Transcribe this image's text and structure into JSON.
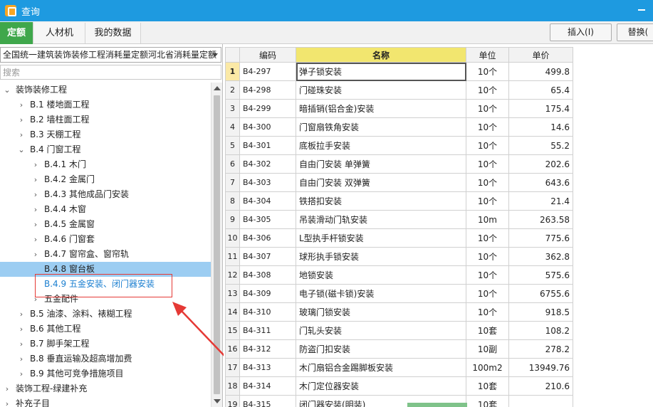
{
  "window": {
    "title": "查询",
    "app_icon": "quota-app-icon",
    "accent": "#1e9ae0"
  },
  "tabs": [
    {
      "label": "定额",
      "active": true
    },
    {
      "label": "人材机",
      "active": false
    },
    {
      "label": "我的数据",
      "active": false
    }
  ],
  "toolbar": {
    "insert_label": "插入(I)",
    "replace_label": "替换("
  },
  "left": {
    "quota_library": "全国统一建筑装饰装修工程消耗量定额河北省消耗量定额",
    "search_placeholder": "搜索",
    "tree": [
      {
        "label": "装饰装修工程",
        "expanded": true
      },
      {
        "label": "B.1 楼地面工程",
        "expanded": false
      },
      {
        "label": "B.2 墙柱面工程",
        "expanded": false
      },
      {
        "label": "B.3 天棚工程",
        "expanded": false
      },
      {
        "label": "B.4 门窗工程",
        "expanded": true
      },
      {
        "label": "B.4.1 木门",
        "expanded": false
      },
      {
        "label": "B.4.2 金属门",
        "expanded": false
      },
      {
        "label": "B.4.3 其他成品门安装",
        "expanded": false
      },
      {
        "label": "B.4.4 木窗",
        "expanded": false
      },
      {
        "label": "B.4.5 金属窗",
        "expanded": false
      },
      {
        "label": "B.4.6 门窗套",
        "expanded": false
      },
      {
        "label": "B.4.7 窗帘盒、窗帘轨",
        "expanded": false
      },
      {
        "label": "B.4.8 窗台板",
        "selected": true
      },
      {
        "label": "B.4.9 五金安装、闭门器安装",
        "highlighted": true
      },
      {
        "label": "五金配件",
        "expanded": false
      },
      {
        "label": "B.5 油漆、涂料、裱糊工程",
        "expanded": false
      },
      {
        "label": "B.6 其他工程",
        "expanded": false
      },
      {
        "label": "B.7 脚手架工程",
        "expanded": false
      },
      {
        "label": "B.8 垂直运输及超高增加费",
        "expanded": false
      },
      {
        "label": "B.9 其他可竞争措施项目",
        "expanded": false
      },
      {
        "label": "装饰工程-绿建补充",
        "expanded": false
      },
      {
        "label": "补充子目",
        "expanded": false
      }
    ]
  },
  "grid": {
    "columns": {
      "code": "编码",
      "name": "名称",
      "unit": "单位",
      "price": "单价"
    },
    "rows": [
      {
        "n": "1",
        "code": "B4-297",
        "name": "弹子锁安装",
        "unit": "10个",
        "price": "499.8"
      },
      {
        "n": "2",
        "code": "B4-298",
        "name": "门碰珠安装",
        "unit": "10个",
        "price": "65.4"
      },
      {
        "n": "3",
        "code": "B4-299",
        "name": "暗插销(铝合金)安装",
        "unit": "10个",
        "price": "175.4"
      },
      {
        "n": "4",
        "code": "B4-300",
        "name": "门窗扇铁角安装",
        "unit": "10个",
        "price": "14.6"
      },
      {
        "n": "5",
        "code": "B4-301",
        "name": "底板拉手安装",
        "unit": "10个",
        "price": "55.2"
      },
      {
        "n": "6",
        "code": "B4-302",
        "name": "自由门安装 单弹簧",
        "unit": "10个",
        "price": "202.6"
      },
      {
        "n": "7",
        "code": "B4-303",
        "name": "自由门安装 双弹簧",
        "unit": "10个",
        "price": "643.6"
      },
      {
        "n": "8",
        "code": "B4-304",
        "name": "铁搭扣安装",
        "unit": "10个",
        "price": "21.4"
      },
      {
        "n": "9",
        "code": "B4-305",
        "name": "吊装滑动门轨安装",
        "unit": "10m",
        "price": "263.58"
      },
      {
        "n": "10",
        "code": "B4-306",
        "name": "L型执手杆锁安装",
        "unit": "10个",
        "price": "775.6"
      },
      {
        "n": "11",
        "code": "B4-307",
        "name": "球形执手锁安装",
        "unit": "10个",
        "price": "362.8"
      },
      {
        "n": "12",
        "code": "B4-308",
        "name": "地锁安装",
        "unit": "10个",
        "price": "575.6"
      },
      {
        "n": "13",
        "code": "B4-309",
        "name": "电子锁(磁卡锁)安装",
        "unit": "10个",
        "price": "6755.6"
      },
      {
        "n": "14",
        "code": "B4-310",
        "name": "玻璃门锁安装",
        "unit": "10个",
        "price": "918.5"
      },
      {
        "n": "15",
        "code": "B4-311",
        "name": "门轧头安装",
        "unit": "10套",
        "price": "108.2"
      },
      {
        "n": "16",
        "code": "B4-312",
        "name": "防盗门扣安装",
        "unit": "10副",
        "price": "278.2"
      },
      {
        "n": "17",
        "code": "B4-313",
        "name": "木门扇铝合金踢脚板安装",
        "unit": "100m2",
        "price": "13949.76"
      },
      {
        "n": "18",
        "code": "B4-314",
        "name": "木门定位器安装",
        "unit": "10套",
        "price": "210.6"
      },
      {
        "n": "19",
        "code": "B4-315",
        "name": "闭门器安装(明装)",
        "unit": "10套",
        "price": ""
      }
    ]
  },
  "colors": {
    "tab_active": "#3fa74b",
    "selected_row": "#9ccdf2",
    "name_header": "#f2e66f",
    "annotation": "#e53935"
  }
}
